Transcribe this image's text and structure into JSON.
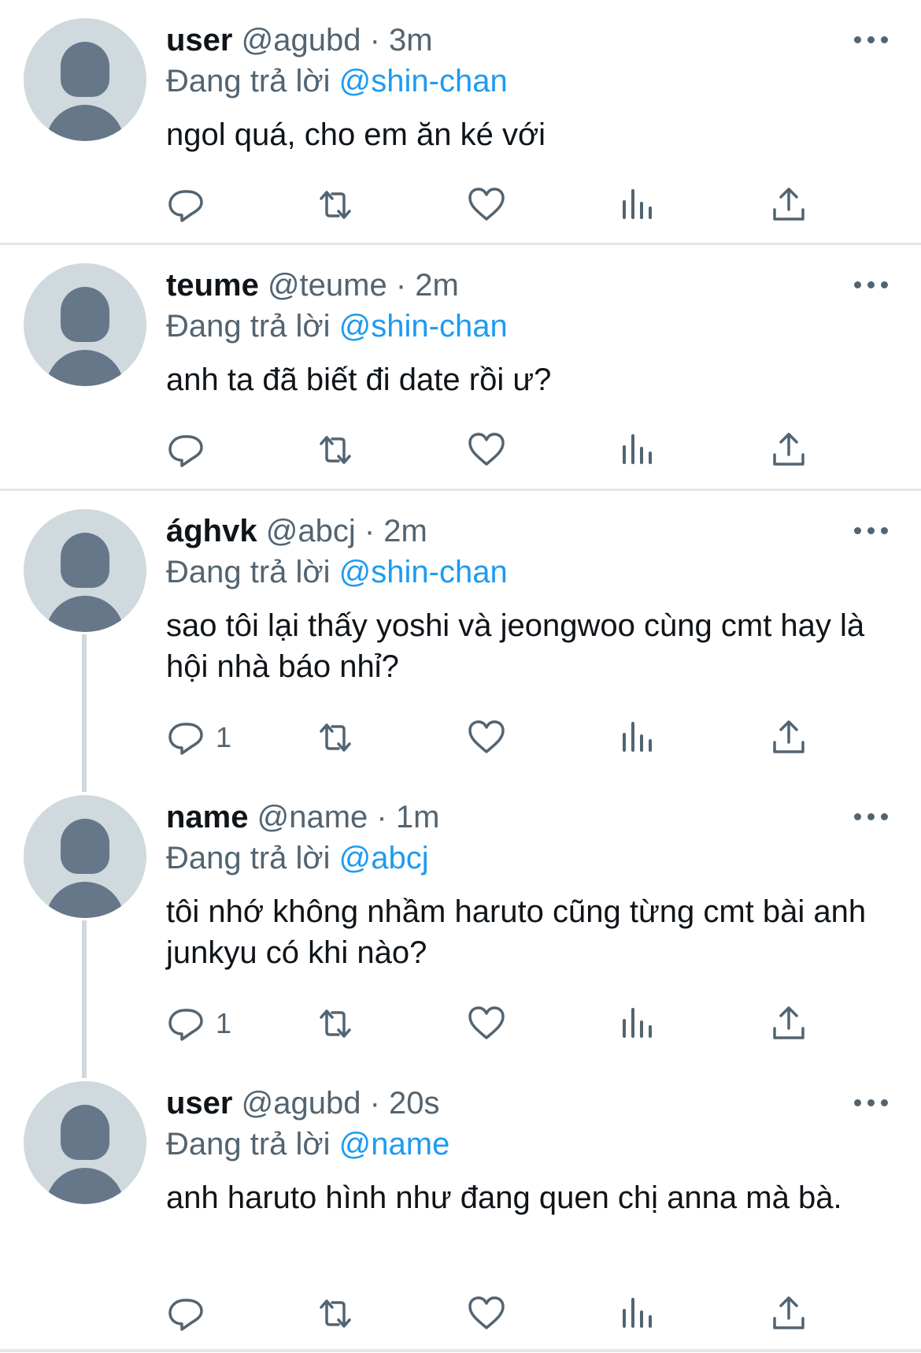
{
  "reply_prefix": "Đang trả lời",
  "tweets": [
    {
      "name": "user",
      "handle": "@agubd",
      "time": "3m",
      "mention": "@shin-chan",
      "text": "ngol quá, cho em ăn ké với",
      "reply_count": ""
    },
    {
      "name": "teume",
      "handle": "@teume",
      "time": "2m",
      "mention": "@shin-chan",
      "text": "anh ta đã biết đi date rồi ư?",
      "reply_count": ""
    },
    {
      "name": "ághvk",
      "handle": "@abcj",
      "time": "2m",
      "mention": "@shin-chan",
      "text": "sao tôi lại thấy yoshi và jeongwoo cùng cmt hay là hội nhà báo nhỉ?",
      "reply_count": "1"
    },
    {
      "name": "name",
      "handle": "@name",
      "time": "1m",
      "mention": "@abcj",
      "text": "tôi nhớ không nhầm haruto cũng từng cmt bài anh junkyu có khi nào?",
      "reply_count": "1"
    },
    {
      "name": "user",
      "handle": "@agubd",
      "time": "20s",
      "mention": "@name",
      "text": "anh haruto hình như đang quen chị anna mà bà.",
      "reply_count": ""
    }
  ],
  "icons": {
    "reply": "speech-bubble-icon",
    "retweet": "retweet-arrows-icon",
    "like": "heart-outline-icon",
    "views": "bar-chart-icon",
    "share": "share-upload-icon",
    "more": "three-dots-icon"
  },
  "colors": {
    "mention": "#1d9bf0",
    "secondary_text": "#536471",
    "avatar_bg": "#cfd9de",
    "avatar_fg": "#66778a",
    "thread_line": "#cfd9de"
  }
}
